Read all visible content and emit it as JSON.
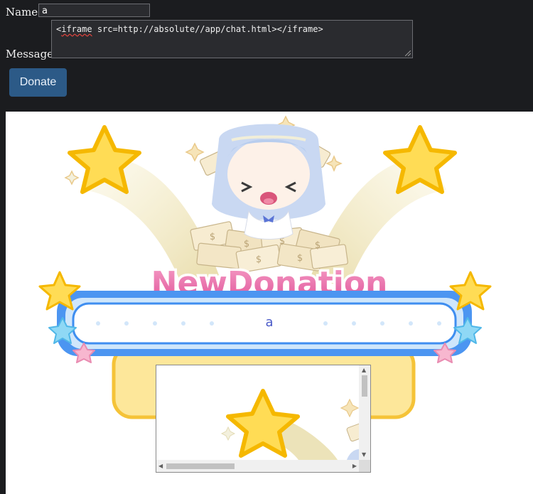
{
  "form": {
    "name_label": "Name:",
    "name_value": "a",
    "message_label": "Message:",
    "message_prefix": "<",
    "message_tag": "iframe",
    "message_rest": " src=http://absolute//app/chat.html></iframe>",
    "donate_label": "Donate"
  },
  "alert": {
    "title": "NewDonation",
    "donor_name": "a"
  },
  "colors": {
    "page_bg": "#1b1c1f",
    "button_bg": "#2c5a87",
    "title_pink": "#e86aa8",
    "banner_blue": "#3f8ef0",
    "star_yellow": "#ffd84a"
  },
  "icons": [
    "star-icon",
    "sparkle-icon",
    "money-bill-icon",
    "resize-grip-icon",
    "scroll-arrow-icon"
  ]
}
